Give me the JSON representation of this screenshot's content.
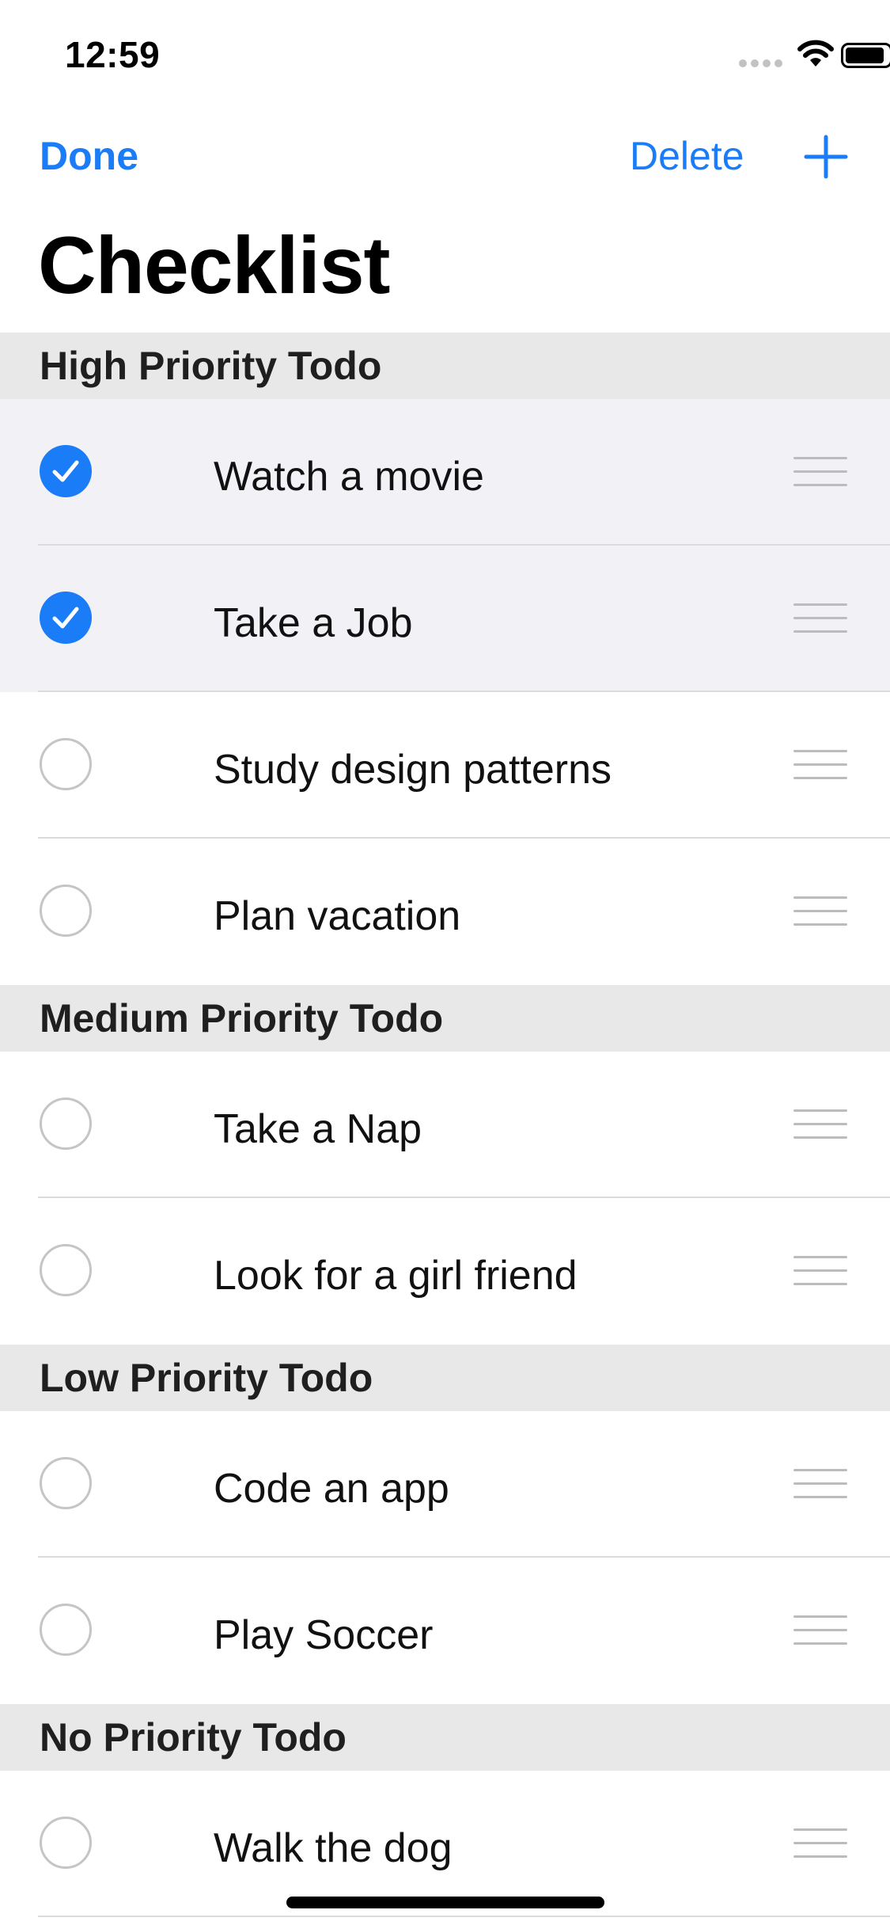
{
  "status_bar": {
    "time": "12:59"
  },
  "nav": {
    "done_label": "Done",
    "delete_label": "Delete"
  },
  "title": "Checklist",
  "colors": {
    "accent": "#1a7cf6",
    "section_bg": "#e8e8e8",
    "checked_row_bg": "#f1f1f6"
  },
  "icons": {
    "add": "plus-icon",
    "checked": "checkmark-circle-icon",
    "unchecked": "empty-circle-icon",
    "reorder": "reorder-handle-icon"
  },
  "sections": [
    {
      "header": "High Priority Todo",
      "items": [
        {
          "label": "Watch a movie",
          "checked": true
        },
        {
          "label": "Take a Job",
          "checked": true
        },
        {
          "label": "Study design patterns",
          "checked": false
        },
        {
          "label": "Plan vacation",
          "checked": false
        }
      ]
    },
    {
      "header": "Medium Priority Todo",
      "items": [
        {
          "label": "Take a Nap",
          "checked": false
        },
        {
          "label": "Look for a girl friend",
          "checked": false
        }
      ]
    },
    {
      "header": "Low Priority Todo",
      "items": [
        {
          "label": "Code an app",
          "checked": false
        },
        {
          "label": "Play Soccer",
          "checked": false
        }
      ]
    },
    {
      "header": "No Priority Todo",
      "items": [
        {
          "label": "Walk the dog",
          "checked": false
        }
      ]
    }
  ]
}
